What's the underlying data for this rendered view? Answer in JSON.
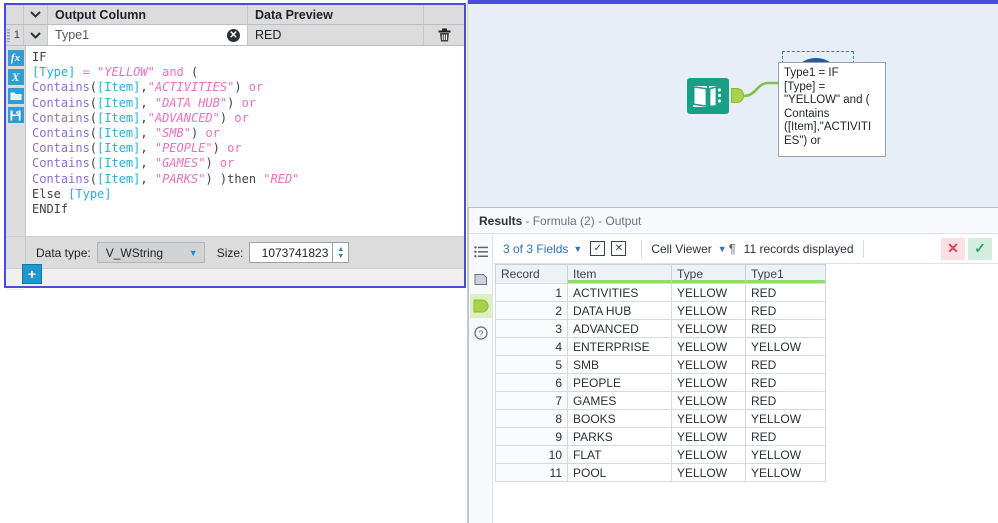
{
  "config_panel": {
    "columns": {
      "output_column": "Output Column",
      "data_preview": "Data Preview"
    },
    "row": {
      "number": "1",
      "output_field_value": "Type1",
      "output_field_placeholder": "Type1",
      "data_preview_value": "RED",
      "clear_icon": "clear-circle-icon",
      "delete_icon": "trash-icon",
      "chevron_icon": "chevron-down-icon"
    },
    "rail_icons": [
      "fx",
      "X",
      "folder-open-icon",
      "save-icon"
    ],
    "formula": {
      "lines": [
        "IF",
        "[Type] = \"YELLOW\" and (",
        "Contains([Item],\"ACTIVITIES\") or",
        "Contains([Item], \"DATA HUB\") or",
        "Contains([Item],\"ADVANCED\") or",
        "Contains([Item], \"SMB\") or",
        "Contains([Item], \"PEOPLE\") or",
        "Contains([Item], \"GAMES\") or",
        "Contains([Item], \"PARKS\") )then \"RED\"",
        "Else [Type]",
        "ENDIf"
      ]
    },
    "data_type": {
      "label": "Data type:",
      "value": "V_WString",
      "size_label": "Size:",
      "size_value": "1073741823"
    },
    "add_button_label": "+"
  },
  "canvas": {
    "input_node_icon": "text-input-node-icon",
    "formula_node_icon": "formula-node-icon",
    "tooltip_text": "Type1 = IF\n[Type] =\n\"YELLOW\" and (\nContains\n([Item],\"ACTIVITI\nES\") or"
  },
  "results": {
    "title_prefix": "Results",
    "title_suffix": " - Formula (2) - Output",
    "toolbar": {
      "fields_label": "3 of 3 Fields",
      "select_all_icon": "checkbox-checked-icon",
      "deselect_all_icon": "checkbox-x-icon",
      "viewer_label": "Cell Viewer",
      "pilcrow_icon": "pilcrow-icon",
      "records_label": "11 records displayed",
      "cancel_icon": "x-icon",
      "confirm_icon": "check-icon"
    },
    "rail_icons": [
      "list-icon",
      "metadata-icon",
      "output-anchor-icon",
      "help-icon"
    ],
    "table": {
      "headers": [
        "Record",
        "Item",
        "Type",
        "Type1"
      ],
      "rows": [
        [
          "1",
          "ACTIVITIES",
          "YELLOW",
          "RED"
        ],
        [
          "2",
          "DATA HUB",
          "YELLOW",
          "RED"
        ],
        [
          "3",
          "ADVANCED",
          "YELLOW",
          "RED"
        ],
        [
          "4",
          "ENTERPRISE",
          "YELLOW",
          "YELLOW"
        ],
        [
          "5",
          "SMB",
          "YELLOW",
          "RED"
        ],
        [
          "6",
          "PEOPLE",
          "YELLOW",
          "RED"
        ],
        [
          "7",
          "GAMES",
          "YELLOW",
          "RED"
        ],
        [
          "8",
          "BOOKS",
          "YELLOW",
          "YELLOW"
        ],
        [
          "9",
          "PARKS",
          "YELLOW",
          "RED"
        ],
        [
          "10",
          "FLAT",
          "YELLOW",
          "YELLOW"
        ],
        [
          "11",
          "POOL",
          "YELLOW",
          "YELLOW"
        ]
      ]
    }
  },
  "colors": {
    "accent_blue": "#4b4bdb",
    "node_blue": "#1c5f9e",
    "node_teal": "#1aa085",
    "anchor_green": "#a9d14a",
    "field_underline_green": "#8ede6b",
    "link_blue": "#2e72c4"
  }
}
